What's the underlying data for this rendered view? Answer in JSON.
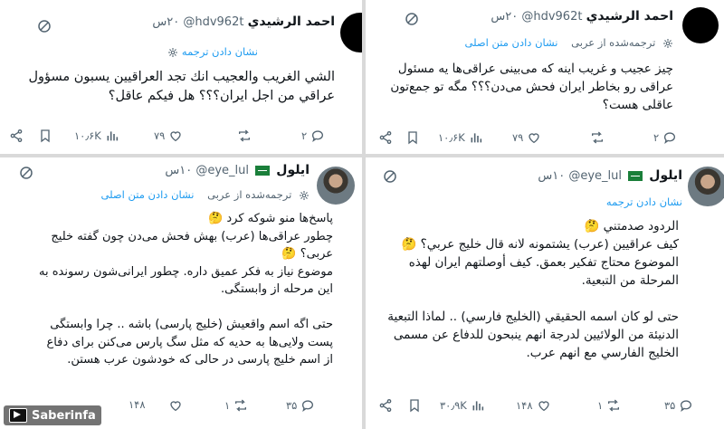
{
  "tweets": [
    {
      "name": "احمد الرشيدي",
      "handle": "@hdv962t",
      "time": "۲۰س",
      "translation_label": "نشان دادن ترجمه",
      "translation_note": "",
      "body": "الشي الغريب والعجيب انك تجد العراقيين يسبون مسؤول\nعراقي من اجل ايران؟؟؟ هل فيكم عاقل؟",
      "stats": {
        "replies": "۲",
        "reposts": "",
        "likes": "۷۹",
        "views": "۱۰٫۶K"
      }
    },
    {
      "name": "احمد الرشيدي",
      "handle": "@hdv962t",
      "time": "۲۰س",
      "translation_note": "ترجمه‌شده از عربی",
      "translation_label": "نشان دادن متن اصلی",
      "body": "چیز عجیب و غریب اینه که می‌بینی عراقی‌ها یه مسئول\nعراقی رو بخاطر ایران فحش می‌دن؟؟؟ مگه تو جمع‌تون\nعاقلی هست؟",
      "stats": {
        "replies": "۲",
        "reposts": "",
        "likes": "۷۹",
        "views": "۱۰٫۶K"
      }
    },
    {
      "name": "ایلول",
      "handle": "@eye_lul",
      "time": "۱۰س",
      "translation_note": "ترجمه‌شده از عربی",
      "translation_label": "نشان دادن متن اصلی",
      "body": "پاسخ‌ها منو شوکه کرد 🤔\nچطور عراقی‌ها (عرب) بهش فحش می‌دن چون گفته خلیج\nعربی؟ 🤔\nموضوع نیاز به فکر عمیق داره. چطور ایرانی‌شون رسونده به\nاین مرحله از وابستگی.\n\nحتی اگه اسم واقعیش (خلیج پارسی) باشه .. چرا وابستگی\nپست ولایی‌ها به حدیه که مثل سگ پارس می‌کنن برای دفاع\nاز اسم خلیج پارسی در حالی که خودشون عرب هستن.",
      "stats": {
        "replies": "۳۵",
        "reposts": "۱",
        "likes": "۱۴۸",
        "views": ""
      }
    },
    {
      "name": "ایلول",
      "handle": "@eye_lul",
      "time": "۱۰س",
      "translation_note": "",
      "translation_label": "نشان دادن ترجمه",
      "body": "الردود صدمتني 🤔\nكيف عراقيين (عرب) يشتمونه لانه قال خليج عربي؟ 🤔\nالموضوع محتاج تفكير بعمق. كيف أوصلتهم ايران لهذه\nالمرحلة من التبعية.\n\nحتى لو كان اسمه الحقيقي (الخليج فارسي) .. لماذا التبعية\nالدنيئة من الولائيين لدرجة انهم ينبحون للدفاع عن مسمى\nالخليج الفارسي مع انهم عرب.",
      "stats": {
        "replies": "۳۵",
        "reposts": "۱",
        "likes": "۱۴۸",
        "views": "۳۰٫۹K"
      }
    }
  ],
  "watermark": "Saberinfa"
}
